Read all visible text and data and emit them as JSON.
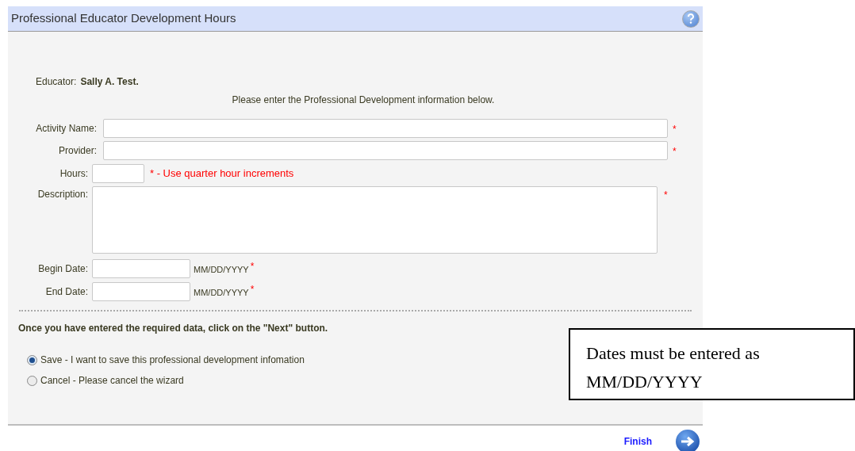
{
  "header": {
    "title": "Professional Educator Development Hours"
  },
  "educator": {
    "label": "Educator:",
    "name": "Sally A. Test."
  },
  "instructions": "Please enter the Professional Development information below.",
  "fields": [
    {
      "kind": "text",
      "label": "Activity Name:",
      "required_mark": "*"
    },
    {
      "kind": "text",
      "label": "Provider:",
      "required_mark": "*"
    },
    {
      "kind": "short",
      "label": "Hours:",
      "note": "* - Use quarter hour increments"
    },
    {
      "kind": "textarea",
      "label": "Description:",
      "required_mark": "*"
    },
    {
      "kind": "date",
      "label": "Begin Date:",
      "hint": "MM/DD/YYYY",
      "required_mark": "*"
    },
    {
      "kind": "date",
      "label": "End Date:",
      "hint": "MM/DD/YYYY",
      "required_mark": "*"
    }
  ],
  "next_note": "Once you have entered the required data, click on the \"Next\" button.",
  "options": [
    {
      "label": "Save - I want to save this professional development infomation",
      "selected": true
    },
    {
      "label": "Cancel - Please cancel the wizard",
      "selected": false
    }
  ],
  "footer": {
    "finish": "Finish"
  },
  "callout": {
    "lines": [
      "Dates must be entered as",
      "MM/DD/YYYY"
    ]
  }
}
